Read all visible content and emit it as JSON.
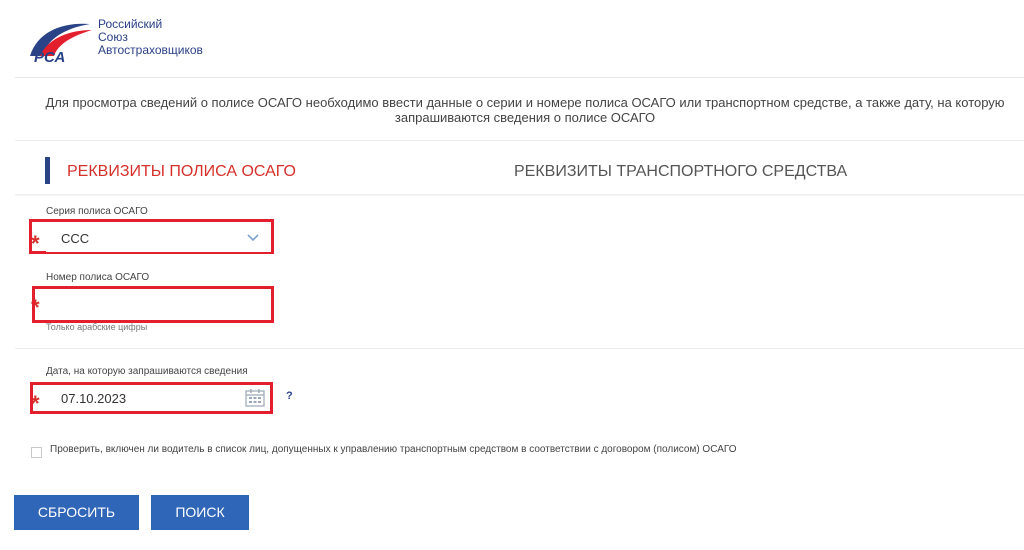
{
  "logo": {
    "mark_text": "РСА",
    "line1": "Российский",
    "line2": "Союз",
    "line3": "Автостраховщиков"
  },
  "intro": {
    "line1": "Для просмотра сведений о полисе ОСАГО необходимо ввести данные о серии и номере полиса ОСАГО или транспортном средстве, а также дату, на которую",
    "line2": "запрашиваются сведения о полисе ОСАГО"
  },
  "tabs": [
    {
      "label": "РЕКВИЗИТЫ ПОЛИСА ОСАГО",
      "active": true
    },
    {
      "label": "РЕКВИЗИТЫ ТРАНСПОРТНОГО СРЕДСТВА",
      "active": false
    }
  ],
  "form": {
    "series": {
      "label": "Серия полиса ОСАГО",
      "value": "ССС",
      "required_mark": "*"
    },
    "number": {
      "label": "Номер полиса ОСАГО",
      "value": "",
      "hint": "Только арабские цифры",
      "required_mark": "*"
    },
    "date": {
      "label": "Дата, на которую запрашиваются сведения",
      "value": "07.10.2023",
      "help": "?",
      "required_mark": "*"
    },
    "check": {
      "label": "Проверить, включен ли водитель в список лиц, допущенных к управлению транспортным средством в соответствии с договором (полисом) ОСАГО",
      "checked": false
    }
  },
  "buttons": {
    "reset": "СБРОСИТЬ",
    "search": "ПОИСК"
  },
  "icons": {
    "logo": "rsa-logo",
    "dropdown": "chevron-down-icon",
    "calendar": "calendar-icon",
    "help": "help-icon"
  },
  "colors": {
    "accent_red": "#d6302b",
    "highlight": "#e31e2d",
    "brand_blue": "#2a4286",
    "button_blue": "#3066b7"
  }
}
